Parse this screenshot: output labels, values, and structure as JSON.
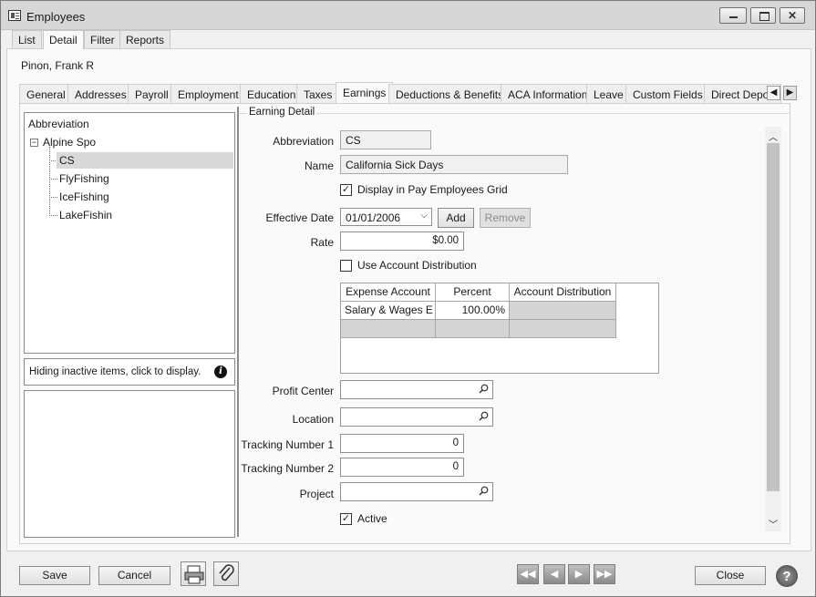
{
  "window": {
    "title": "Employees"
  },
  "top_tabs": [
    "List",
    "Detail",
    "Filter",
    "Reports"
  ],
  "employee_name": "Pinon, Frank R",
  "sub_tabs": [
    "General",
    "Addresses",
    "Payroll",
    "Employment",
    "Education",
    "Taxes",
    "Earnings",
    "Deductions & Benefits",
    "ACA Information",
    "Leave",
    "Custom Fields",
    "Direct Depos"
  ],
  "tree": {
    "header": "Abbreviation",
    "root": "Alpine Spo",
    "expander": "−",
    "items": [
      "CS",
      "FlyFishing",
      "IceFishing",
      "LakeFishin"
    ]
  },
  "hint": {
    "text": "Hiding inactive items, click to display.",
    "icon": "info-icon"
  },
  "detail": {
    "group_title": "Earning Detail",
    "abbreviation_label": "Abbreviation",
    "abbreviation": "CS",
    "name_label": "Name",
    "name": "California Sick Days",
    "display_grid_label": "Display in Pay Employees Grid",
    "display_grid_checked": "✓",
    "effective_date_label": "Effective Date",
    "effective_date": "01/01/2006",
    "add_label": "Add",
    "remove_label": "Remove",
    "rate_label": "Rate",
    "rate": "$0.00",
    "use_account_dist_label": "Use Account Distribution",
    "grid": {
      "headers": [
        "Expense Account",
        "Percent",
        "Account Distribution"
      ],
      "rows": [
        [
          "Salary & Wages E",
          "100.00%",
          ""
        ]
      ]
    },
    "profit_center_label": "Profit Center",
    "profit_center": "",
    "location_label": "Location",
    "location": "",
    "tracking1_label": "Tracking Number 1",
    "tracking1": "0",
    "tracking2_label": "Tracking Number 2",
    "tracking2": "0",
    "project_label": "Project",
    "project": "",
    "active_label": "Active",
    "active_checked": "✓"
  },
  "footer": {
    "save": "Save",
    "cancel": "Cancel",
    "close": "Close",
    "help": "?"
  }
}
